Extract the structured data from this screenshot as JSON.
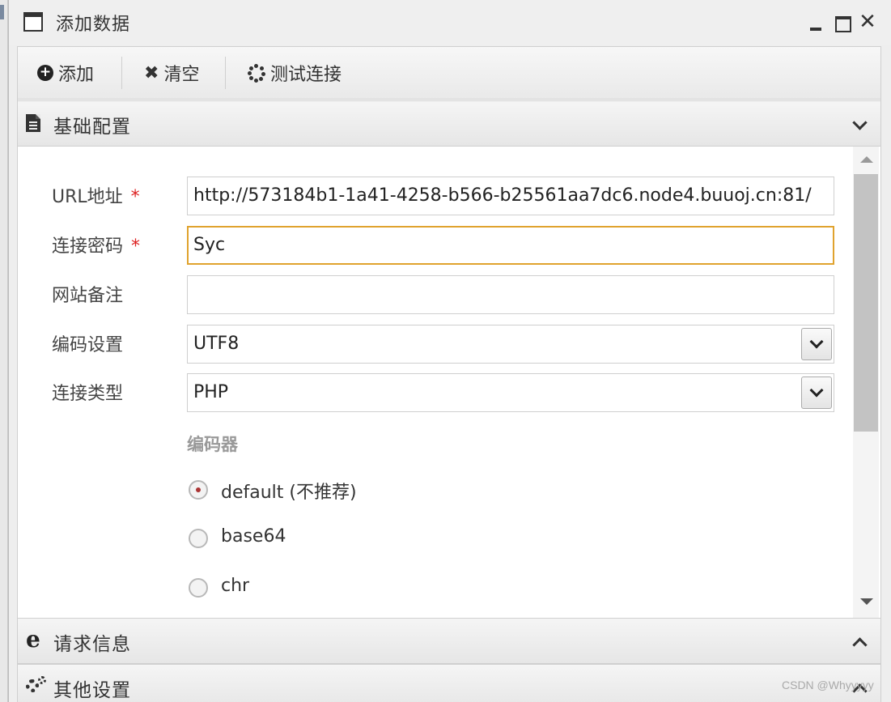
{
  "window": {
    "title": "添加数据"
  },
  "toolbar": {
    "add_label": "添加",
    "clear_label": "清空",
    "test_label": "测试连接"
  },
  "sections": {
    "basic": {
      "label": "基础配置"
    },
    "request": {
      "label": "请求信息"
    },
    "other": {
      "label": "其他设置"
    }
  },
  "form": {
    "url": {
      "label": "URL地址",
      "required_mark": "*",
      "value": "http://573184b1-1a41-4258-b566-b25561aa7dc6.node4.buuoj.cn:81/"
    },
    "password": {
      "label": "连接密码",
      "required_mark": "*",
      "value": "Syc"
    },
    "note": {
      "label": "网站备注",
      "value": ""
    },
    "encoding": {
      "label": "编码设置",
      "value": "UTF8"
    },
    "conn_type": {
      "label": "连接类型",
      "value": "PHP"
    },
    "encoder": {
      "label": "编码器",
      "options": [
        {
          "label": "default (不推荐)",
          "checked": true
        },
        {
          "label": "base64",
          "checked": false
        },
        {
          "label": "chr",
          "checked": false
        }
      ]
    }
  },
  "watermark": "CSDN @Whyyyyy"
}
